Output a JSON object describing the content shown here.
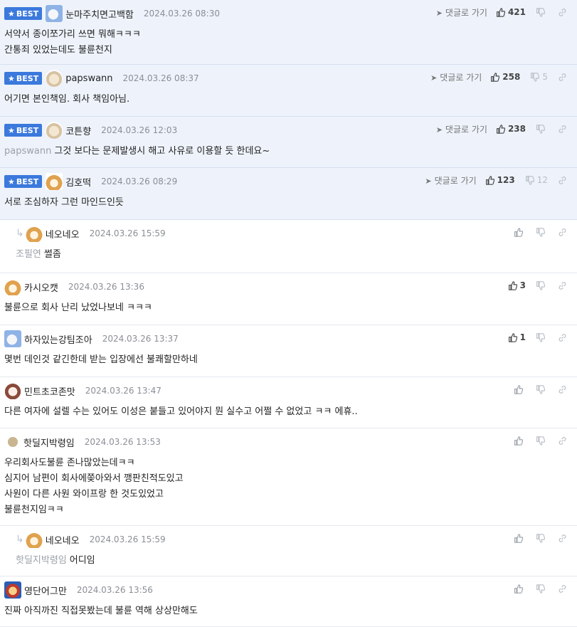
{
  "ui": {
    "best_label": "BEST",
    "goto_label": "댓글로 가기"
  },
  "comments": [
    {
      "best": true,
      "reply": false,
      "avatar": "blue-dog",
      "nick": "눈마주치면고백함",
      "date": "2024.03.26 08:30",
      "likes": "421",
      "dislikes": "",
      "goto": true,
      "mention": "",
      "lines": [
        "서약서 종이쪼가리 쓰면 뭐해ㅋㅋㅋ",
        "간통죄 있었는데도 불륜천지"
      ]
    },
    {
      "best": true,
      "reply": false,
      "avatar": "puppy",
      "nick": "papswann",
      "date": "2024.03.26 08:37",
      "likes": "258",
      "dislikes": "5",
      "goto": true,
      "mention": "",
      "lines": [
        "어기면 본인책임. 회사 책임아님."
      ]
    },
    {
      "best": true,
      "reply": false,
      "avatar": "puppy",
      "nick": "코튼향",
      "date": "2024.03.26 12:03",
      "likes": "238",
      "dislikes": "",
      "goto": true,
      "mention": "papswann",
      "lines": [
        "그것 보다는 문제발생시 해고 사유로 이용할 듯 한데요~"
      ]
    },
    {
      "best": true,
      "reply": false,
      "avatar": "fox",
      "nick": "김호떡",
      "date": "2024.03.26 08:29",
      "likes": "123",
      "dislikes": "12",
      "goto": true,
      "mention": "",
      "lines": [
        "서로 조심하자 그런 마인드인듯"
      ]
    },
    {
      "best": false,
      "reply": true,
      "avatar": "fox",
      "nick": "네오네오",
      "date": "2024.03.26 15:59",
      "likes": "",
      "dislikes": "",
      "goto": false,
      "mention": "조필연",
      "lines": [
        "썰좀"
      ]
    },
    {
      "best": false,
      "reply": false,
      "avatar": "fox",
      "nick": "카시오캣",
      "date": "2024.03.26 13:36",
      "likes": "3",
      "dislikes": "",
      "goto": false,
      "mention": "",
      "lines": [
        "불륜으로 회사 난리 났었나보네 ㅋㅋㅋ"
      ]
    },
    {
      "best": false,
      "reply": false,
      "avatar": "blue-dog",
      "nick": "하자있는강팀조아",
      "date": "2024.03.26 13:37",
      "likes": "1",
      "dislikes": "",
      "goto": false,
      "mention": "",
      "lines": [
        "몇번 데인것 같긴한데 받는 입장에선 불쾌할만하네"
      ]
    },
    {
      "best": false,
      "reply": false,
      "avatar": "dog-face",
      "nick": "민트초코존맛",
      "date": "2024.03.26 13:47",
      "likes": "",
      "dislikes": "",
      "goto": false,
      "mention": "",
      "lines": [
        "다른 여자에 설렐 수는 있어도 이성은 붙들고 있어야지 뭔 실수고 어쩔 수 없었고 ㅋㅋ 에휴.."
      ]
    },
    {
      "best": false,
      "reply": false,
      "avatar": "dot",
      "nick": "핫딜지박령임",
      "date": "2024.03.26 13:53",
      "likes": "",
      "dislikes": "",
      "goto": false,
      "mention": "",
      "lines": [
        "우리회사도불륜 존나많았는데ㅋㅋ",
        "심지어 남편이 회사에쫒아와서 깽판친적도있고",
        "사원이 다른 사원 와이프랑 한 것도있었고",
        "불륜천지임ㅋㅋ"
      ]
    },
    {
      "best": false,
      "reply": true,
      "avatar": "fox",
      "nick": "네오네오",
      "date": "2024.03.26 15:59",
      "likes": "",
      "dislikes": "",
      "goto": false,
      "mention": "핫딜지박령임",
      "lines": [
        "어디임"
      ]
    },
    {
      "best": false,
      "reply": false,
      "avatar": "lion",
      "nick": "영단어그만",
      "date": "2024.03.26 13:56",
      "likes": "",
      "dislikes": "",
      "goto": false,
      "mention": "",
      "lines": [
        "진짜 아직까진 직접못봤는데 불륜 역해 상상만해도"
      ]
    }
  ],
  "colors": {
    "best_bg": "#eef3fb",
    "badge": "#3b79dc"
  }
}
